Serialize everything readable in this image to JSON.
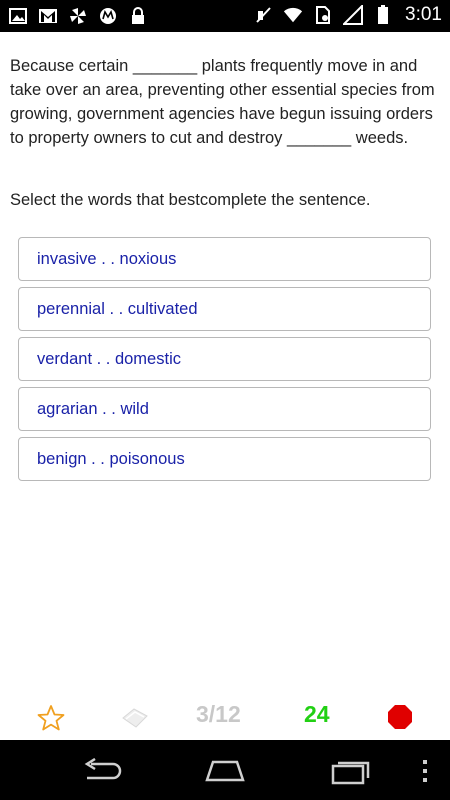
{
  "status_bar": {
    "time": "3:01",
    "icons_left": [
      "image-icon",
      "gmail-icon",
      "pinwheel-icon",
      "motorola-icon",
      "lock-icon"
    ],
    "icons_right": [
      "mute-icon",
      "wifi-icon",
      "sim-icon",
      "signal-icon",
      "battery-icon"
    ]
  },
  "question": {
    "text": "Because certain _______ plants frequently move in and take over an area, preventing other essential species from growing, government agencies have begun issuing orders to property owners to cut and destroy _______ weeds."
  },
  "instruction": "Select the words that bestcomplete the sentence.",
  "options": [
    "invasive . . noxious",
    "perennial . . cultivated",
    "verdant . . domestic",
    "agrarian . . wild",
    "benign . . poisonous"
  ],
  "toolbar": {
    "progress": "3/12",
    "score": "24",
    "colors": {
      "progress": "#c8c8c8",
      "score": "#22d014",
      "star": "#f0a020",
      "stop": "#e00000"
    }
  },
  "nav": {
    "buttons": [
      "back",
      "home",
      "recent-apps",
      "menu"
    ]
  }
}
